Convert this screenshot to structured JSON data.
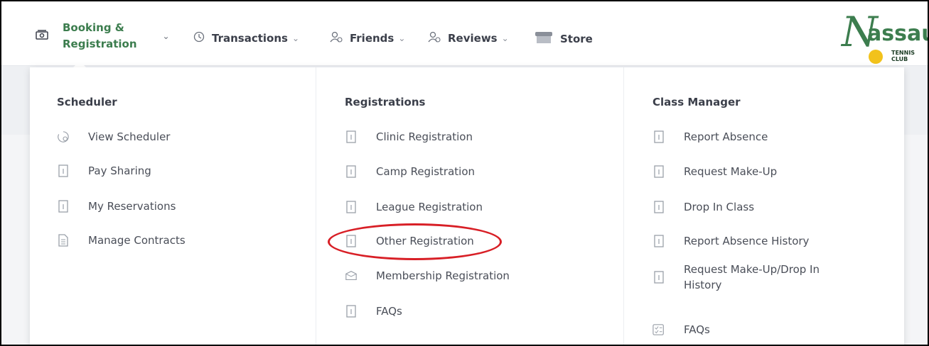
{
  "nav": {
    "items": [
      {
        "label_line1": "Booking &",
        "label_line2": "Registration",
        "icon": "cash-icon",
        "active": true
      },
      {
        "label": "Transactions",
        "icon": "history-icon"
      },
      {
        "label": "Friends",
        "icon": "add-user-icon"
      },
      {
        "label": "Reviews",
        "icon": "add-user-icon"
      },
      {
        "label": "Store",
        "icon": "store-icon"
      }
    ],
    "chevron": "⌄"
  },
  "logo": {
    "letter": "N",
    "text": "assau",
    "sub": "TENNIS CLUB"
  },
  "menu": {
    "columns": [
      {
        "title": "Scheduler",
        "items": [
          {
            "label": "View Scheduler",
            "icon": "clock-icon"
          },
          {
            "label": "Pay Sharing",
            "icon": "document-icon"
          },
          {
            "label": "My Reservations",
            "icon": "document-icon"
          },
          {
            "label": "Manage Contracts",
            "icon": "contract-icon"
          }
        ]
      },
      {
        "title": "Registrations",
        "items": [
          {
            "label": "Clinic Registration",
            "icon": "document-icon"
          },
          {
            "label": "Camp Registration",
            "icon": "document-icon"
          },
          {
            "label": "League Registration",
            "icon": "document-icon"
          },
          {
            "label": "Other Registration",
            "icon": "document-icon"
          },
          {
            "label": "Membership Registration",
            "icon": "box-icon"
          },
          {
            "label": "FAQs",
            "icon": "document-icon"
          }
        ]
      },
      {
        "title": "Class Manager",
        "items": [
          {
            "label": "Report Absence",
            "icon": "document-icon"
          },
          {
            "label": "Request Make-Up",
            "icon": "document-icon"
          },
          {
            "label": "Drop In Class",
            "icon": "document-icon"
          },
          {
            "label": "Report Absence History",
            "icon": "document-icon"
          },
          {
            "label_line1": "Request Make-Up/Drop In",
            "label_line2": "History",
            "icon": "document-icon"
          },
          {
            "label": "FAQs",
            "icon": "checklist-icon"
          }
        ]
      }
    ]
  },
  "colors": {
    "accent": "#3c7d4e",
    "highlight": "#d81f26",
    "text": "#3b3f4a"
  }
}
